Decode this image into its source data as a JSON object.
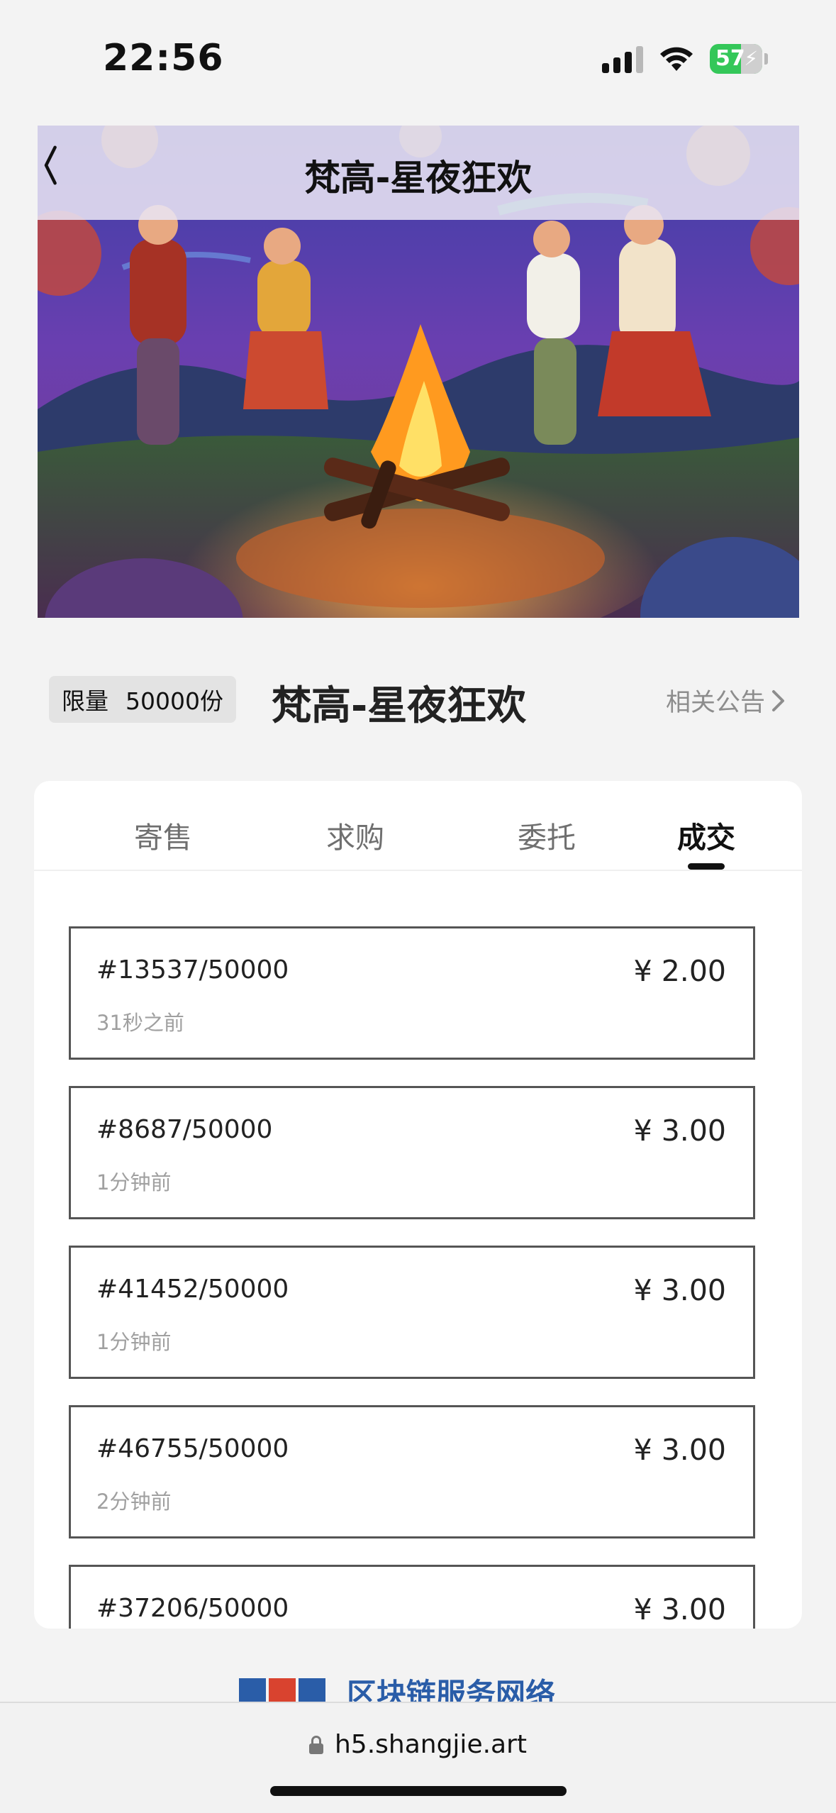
{
  "status_bar": {
    "time": "22:56",
    "battery": "57"
  },
  "header": {
    "title": "梵高-星夜狂欢",
    "back_icon": "chevron-left-icon"
  },
  "info": {
    "limit_label": "限量",
    "limit_value": "50000份",
    "name": "梵高-星夜狂欢",
    "notice_label": "相关公告",
    "notice_icon": "chevron-right-icon"
  },
  "tabs": [
    {
      "label": "寄售",
      "active": false
    },
    {
      "label": "求购",
      "active": false
    },
    {
      "label": "委托",
      "active": false
    },
    {
      "label": "成交",
      "active": true
    }
  ],
  "trades": [
    {
      "id": "#13537/50000",
      "time": "31秒之前",
      "price": "¥ 2.00"
    },
    {
      "id": "#8687/50000",
      "time": "1分钟前",
      "price": "¥ 3.00"
    },
    {
      "id": "#41452/50000",
      "time": "1分钟前",
      "price": "¥ 3.00"
    },
    {
      "id": "#46755/50000",
      "time": "2分钟前",
      "price": "¥ 3.00"
    },
    {
      "id": "#37206/50000",
      "time": "",
      "price": "¥ 3.00"
    }
  ],
  "footer": {
    "text": "区块链服务网络",
    "url": "h5.shangjie.art"
  },
  "colors": {
    "background": "#f3f3f3",
    "active_tab": "#111111",
    "battery": "#34c759",
    "footer_brand": "#2a5da8"
  }
}
